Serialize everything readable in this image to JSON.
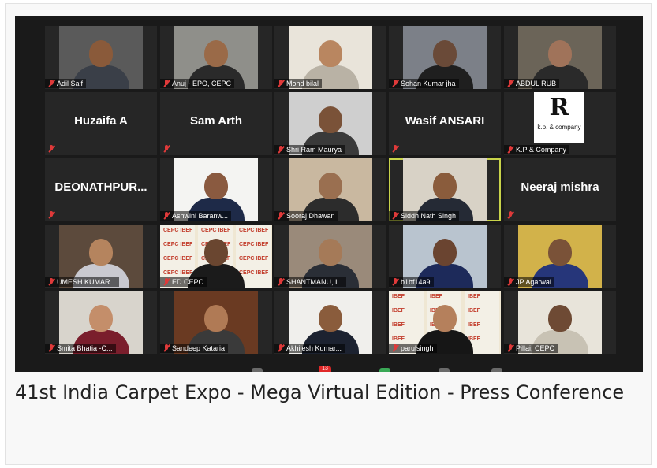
{
  "caption": "41st India Carpet Expo - Mega Virtual Edition - Press Conference",
  "participants": [
    {
      "name": "Adil Saif",
      "type": "video",
      "bg": "#5a5a5a",
      "skin": "#8a5a3a",
      "shirt": "#3a3f48"
    },
    {
      "name": "Anuj - EPO, CEPC",
      "type": "video",
      "bg": "#8f8f8a",
      "skin": "#9a6a48",
      "shirt": "#2a2a2a"
    },
    {
      "name": "Mohd bilal",
      "type": "video",
      "bg": "#e9e4da",
      "skin": "#b98660",
      "shirt": "#b9b2a5"
    },
    {
      "name": "Sohan Kumar jha",
      "type": "video",
      "bg": "#7c8088",
      "skin": "#6a4a38",
      "shirt": "#1f1f1f"
    },
    {
      "name": "ABDUL RUB",
      "type": "video",
      "bg": "#6b6458",
      "skin": "#a0735a",
      "shirt": "#2a2a2a"
    },
    {
      "name": "Huzaifa A",
      "type": "name"
    },
    {
      "name": "Sam Arth",
      "type": "name"
    },
    {
      "name": "Shri Ram Maurya",
      "type": "video",
      "bg": "#cfcfcf",
      "skin": "#7a5238",
      "shirt": "#3a3a3a"
    },
    {
      "name": "Wasif ANSARI",
      "type": "name"
    },
    {
      "name": "K.P & Company",
      "type": "logo",
      "logo_mark": "R",
      "logo_text": "k.p. & company"
    },
    {
      "name": "DEONATHPUR...",
      "type": "name"
    },
    {
      "name": "Ashwini Baranw...",
      "type": "video",
      "bg": "#f4f4f2",
      "skin": "#8a5a40",
      "shirt": "#1e2a48"
    },
    {
      "name": "Sooraj Dhawan",
      "type": "video",
      "bg": "#c9b8a0",
      "skin": "#9a6f50",
      "shirt": "#2c2c2c"
    },
    {
      "name": "Siddh Nath Singh",
      "type": "video",
      "bg": "#d8d2c6",
      "skin": "#8a5c3c",
      "shirt": "#252a35",
      "active": true
    },
    {
      "name": "Neeraj mishra",
      "type": "name"
    },
    {
      "name": "UMESH KUMAR...",
      "type": "video",
      "bg": "#5c4a3c",
      "skin": "#b5845e",
      "shirt": "#c9c9d0"
    },
    {
      "name": "ED CEPC",
      "type": "banner",
      "skin": "#6a4630",
      "shirt": "#1b1b1b",
      "banner_label": "CEPC IBEF"
    },
    {
      "name": "SHANTMANU, I...",
      "type": "video",
      "bg": "#9a8a7a",
      "skin": "#a57a58",
      "shirt": "#2a2e36"
    },
    {
      "name": "b1bf14a9",
      "type": "video",
      "bg": "#b9c4cf",
      "skin": "#6a4430",
      "shirt": "#1d2a5a"
    },
    {
      "name": "JP Agarwal",
      "type": "video",
      "bg": "#d2b24a",
      "skin": "#7a5238",
      "shirt": "#26367a"
    },
    {
      "name": "Smita Bhatia -C...",
      "type": "video",
      "bg": "#d8d4cc",
      "skin": "#c48e6a",
      "shirt": "#7a1e2c"
    },
    {
      "name": "Sandeep Kataria",
      "type": "video",
      "bg": "#6a3a22",
      "skin": "#b07a55",
      "shirt": "#3a3a3a"
    },
    {
      "name": "Akhilesh Kumar...",
      "type": "video",
      "bg": "#f0efec",
      "skin": "#8a5c3c",
      "shirt": "#1c2230"
    },
    {
      "name": "parulsingh",
      "type": "banner",
      "skin": "#b5805c",
      "shirt": "#161616",
      "banner_label": "IBEF"
    },
    {
      "name": "Pillai, CEPC",
      "type": "video",
      "bg": "#e8e4da",
      "skin": "#6e4a34",
      "shirt": "#c8c2b4"
    }
  ],
  "toolbar": {
    "chat_badge": "13"
  }
}
